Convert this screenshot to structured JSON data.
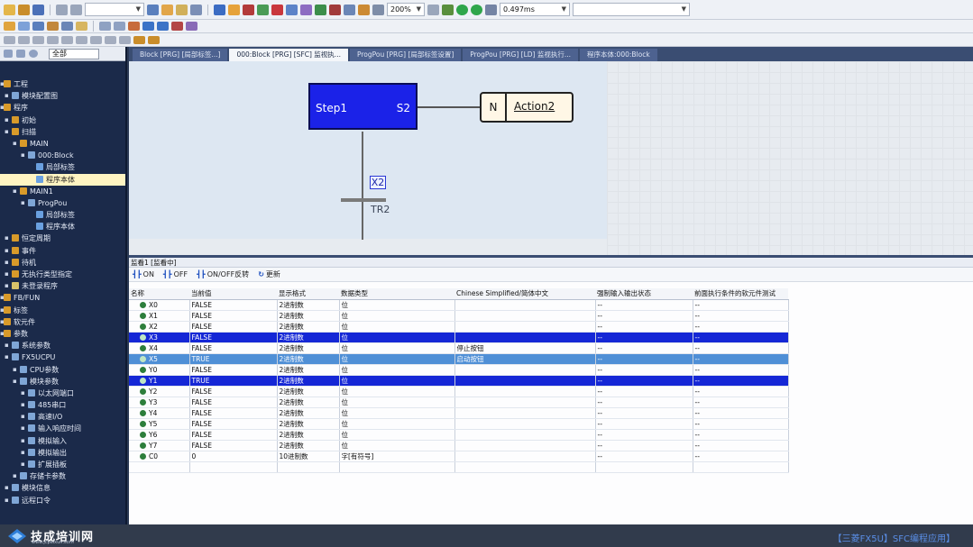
{
  "toolbar": {
    "zoom": "200%",
    "scan_time": "0.497ms",
    "project_combo": ""
  },
  "nav": {
    "search_value": "全部",
    "items": [
      {
        "label": "工程",
        "indent": 0,
        "color": "#d89a2a"
      },
      {
        "label": "模块配置图",
        "indent": 1,
        "color": "#7fa6d6"
      },
      {
        "label": "程序",
        "indent": 0,
        "color": "#d89a2a"
      },
      {
        "label": "初始",
        "indent": 1,
        "color": "#d89a2a"
      },
      {
        "label": "扫描",
        "indent": 1,
        "color": "#d89a2a"
      },
      {
        "label": "MAIN",
        "indent": 2,
        "color": "#d89a2a"
      },
      {
        "label": "000:Block",
        "indent": 3,
        "color": "#7fa6d6"
      },
      {
        "label": "局部标签",
        "indent": 4,
        "color": "#6aa0e0"
      },
      {
        "label": "程序本体",
        "indent": 4,
        "color": "#6aa0e0",
        "selected": true
      },
      {
        "label": "MAIN1",
        "indent": 2,
        "color": "#d89a2a"
      },
      {
        "label": "ProgPou",
        "indent": 3,
        "color": "#7fa6d6"
      },
      {
        "label": "局部标签",
        "indent": 4,
        "color": "#6aa0e0"
      },
      {
        "label": "程序本体",
        "indent": 4,
        "color": "#6aa0e0"
      },
      {
        "label": "恒定周期",
        "indent": 1,
        "color": "#d89a2a"
      },
      {
        "label": "事件",
        "indent": 1,
        "color": "#d89a2a"
      },
      {
        "label": "待机",
        "indent": 1,
        "color": "#d89a2a"
      },
      {
        "label": "无执行类型指定",
        "indent": 1,
        "color": "#d89a2a"
      },
      {
        "label": "未登录程序",
        "indent": 1,
        "color": "#d8c36a"
      },
      {
        "label": "FB/FUN",
        "indent": 0,
        "color": "#d89a2a"
      },
      {
        "label": "标签",
        "indent": 0,
        "color": "#d89a2a"
      },
      {
        "label": "软元件",
        "indent": 0,
        "color": "#d89a2a"
      },
      {
        "label": "参数",
        "indent": 0,
        "color": "#d89a2a"
      },
      {
        "label": "系统参数",
        "indent": 1,
        "color": "#7fa6d6"
      },
      {
        "label": "FX5UCPU",
        "indent": 1,
        "color": "#7fa6d6"
      },
      {
        "label": "CPU参数",
        "indent": 2,
        "color": "#7fa6d6"
      },
      {
        "label": "模块参数",
        "indent": 2,
        "color": "#7fa6d6"
      },
      {
        "label": "以太网端口",
        "indent": 3,
        "color": "#7fa6d6"
      },
      {
        "label": "485串口",
        "indent": 3,
        "color": "#7fa6d6"
      },
      {
        "label": "高速I/O",
        "indent": 3,
        "color": "#7fa6d6"
      },
      {
        "label": "输入响应时间",
        "indent": 3,
        "color": "#7fa6d6"
      },
      {
        "label": "模拟输入",
        "indent": 3,
        "color": "#7fa6d6"
      },
      {
        "label": "模拟输出",
        "indent": 3,
        "color": "#7fa6d6"
      },
      {
        "label": "扩展插板",
        "indent": 3,
        "color": "#7fa6d6"
      },
      {
        "label": "存储卡参数",
        "indent": 2,
        "color": "#7fa6d6"
      },
      {
        "label": "模块信息",
        "indent": 1,
        "color": "#7fa6d6"
      },
      {
        "label": "远程口令",
        "indent": 1,
        "color": "#7fa6d6"
      }
    ]
  },
  "tabs": [
    {
      "label": "Block [PRG] [局部标签...]",
      "active": false
    },
    {
      "label": "000:Block [PRG] [SFC] 监视执...",
      "active": true
    },
    {
      "label": "ProgPou [PRG] [局部标签设置]",
      "active": false
    },
    {
      "label": "ProgPou [PRG] [LD] 监视执行...",
      "active": false
    },
    {
      "label": "程序本体:000:Block",
      "active": false
    }
  ],
  "sfc": {
    "step_name": "Step1",
    "step_id": "S2",
    "action_qualifier": "N",
    "action_name": "Action2",
    "transition_condition": "X2",
    "transition_id": "TR2"
  },
  "monitor": {
    "title": "监看1 [监看中]",
    "buttons": [
      "ON",
      "OFF",
      "ON/OFF反转",
      "更新"
    ],
    "columns": [
      "名称",
      "当前值",
      "显示格式",
      "数据类型",
      "Chinese Simplified/简体中文",
      "强制输入输出状态",
      "前面执行条件的软元件测试"
    ],
    "rows": [
      {
        "name": "X0",
        "value": "FALSE",
        "format": "2进制数",
        "type": "位",
        "comment": "",
        "force": "--",
        "test": "--",
        "state": "normal"
      },
      {
        "name": "X1",
        "value": "FALSE",
        "format": "2进制数",
        "type": "位",
        "comment": "",
        "force": "--",
        "test": "--",
        "state": "normal"
      },
      {
        "name": "X2",
        "value": "FALSE",
        "format": "2进制数",
        "type": "位",
        "comment": "",
        "force": "--",
        "test": "--",
        "state": "normal"
      },
      {
        "name": "X3",
        "value": "FALSE",
        "format": "2进制数",
        "type": "位",
        "comment": "",
        "force": "--",
        "test": "--",
        "state": "selected"
      },
      {
        "name": "X4",
        "value": "FALSE",
        "format": "2进制数",
        "type": "位",
        "comment": "停止按钮",
        "force": "--",
        "test": "--",
        "state": "normal"
      },
      {
        "name": "X5",
        "value": "TRUE",
        "format": "2进制数",
        "type": "位",
        "comment": "启动按钮",
        "force": "--",
        "test": "--",
        "state": "highlight"
      },
      {
        "name": "Y0",
        "value": "FALSE",
        "format": "2进制数",
        "type": "位",
        "comment": "",
        "force": "--",
        "test": "--",
        "state": "normal"
      },
      {
        "name": "Y1",
        "value": "TRUE",
        "format": "2进制数",
        "type": "位",
        "comment": "",
        "force": "--",
        "test": "--",
        "state": "selected"
      },
      {
        "name": "Y2",
        "value": "FALSE",
        "format": "2进制数",
        "type": "位",
        "comment": "",
        "force": "--",
        "test": "--",
        "state": "normal"
      },
      {
        "name": "Y3",
        "value": "FALSE",
        "format": "2进制数",
        "type": "位",
        "comment": "",
        "force": "--",
        "test": "--",
        "state": "normal"
      },
      {
        "name": "Y4",
        "value": "FALSE",
        "format": "2进制数",
        "type": "位",
        "comment": "",
        "force": "--",
        "test": "--",
        "state": "normal"
      },
      {
        "name": "Y5",
        "value": "FALSE",
        "format": "2进制数",
        "type": "位",
        "comment": "",
        "force": "--",
        "test": "--",
        "state": "normal"
      },
      {
        "name": "Y6",
        "value": "FALSE",
        "format": "2进制数",
        "type": "位",
        "comment": "",
        "force": "--",
        "test": "--",
        "state": "normal"
      },
      {
        "name": "Y7",
        "value": "FALSE",
        "format": "2进制数",
        "type": "位",
        "comment": "",
        "force": "--",
        "test": "--",
        "state": "normal"
      },
      {
        "name": "C0",
        "value": "0",
        "format": "10进制数",
        "type": "字[有符号]",
        "comment": "",
        "force": "--",
        "test": "--",
        "state": "normal"
      }
    ]
  },
  "status": {
    "logo_text": "技成培训网",
    "logo_url": "www.jcpeixun.com",
    "course_title": "【三菱FX5U】SFC编程应用】"
  },
  "colors": {
    "step_fill": "#1b22e8",
    "row_selected": "#1527d6",
    "row_highlight": "#4f8fd6",
    "nav_bg": "#1b2a4a"
  }
}
